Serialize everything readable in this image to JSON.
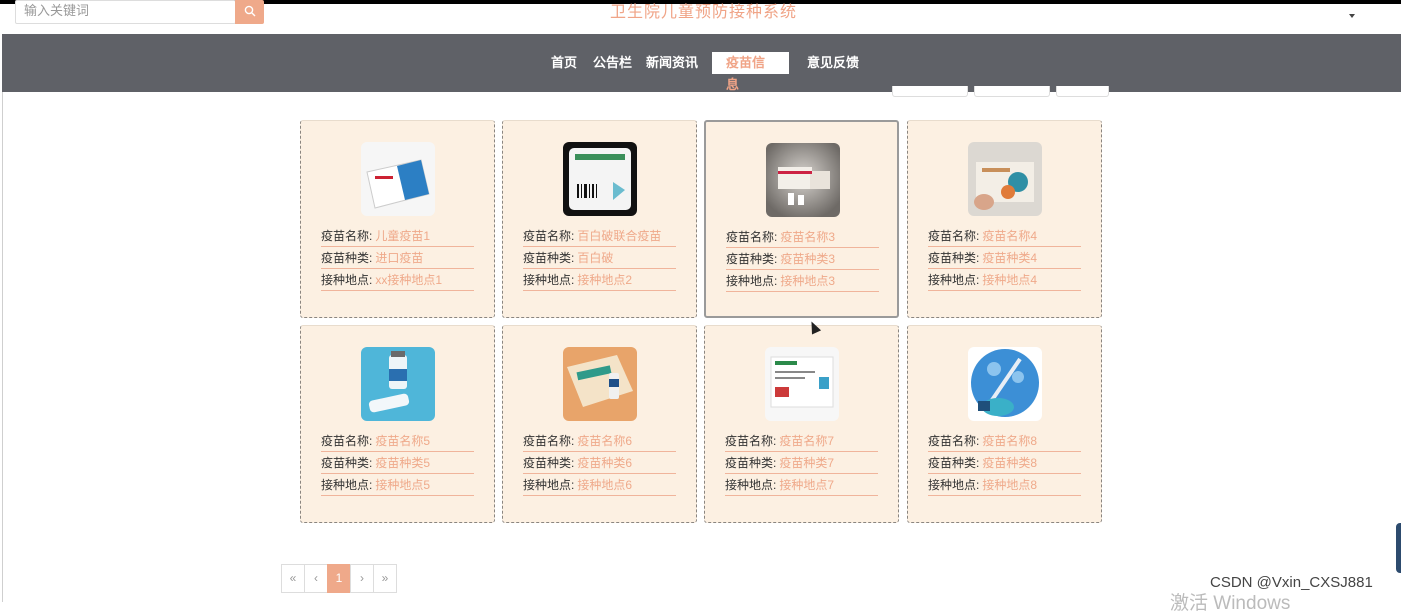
{
  "header": {
    "search_placeholder": "输入关键词",
    "search_icon": "search-icon",
    "site_title": "卫生院儿童预防接种系统"
  },
  "nav": {
    "items": [
      {
        "label": "首页"
      },
      {
        "label": "公告栏"
      },
      {
        "label": "新闻资讯"
      },
      {
        "label": "疫苗信息",
        "active": true
      },
      {
        "label": "意见反馈"
      }
    ]
  },
  "field_labels": {
    "name": "疫苗名称:",
    "type": "疫苗种类:",
    "place": "接种地点:"
  },
  "cards": [
    {
      "name": "儿童疫苗1",
      "type": "进口疫苗",
      "place": "xx接种地点1"
    },
    {
      "name": "百白破联合疫苗",
      "type": "百白破",
      "place": "接种地点2"
    },
    {
      "name": "疫苗名称3",
      "type": "疫苗种类3",
      "place": "接种地点3"
    },
    {
      "name": "疫苗名称4",
      "type": "疫苗种类4",
      "place": "接种地点4"
    },
    {
      "name": "疫苗名称5",
      "type": "疫苗种类5",
      "place": "接种地点5"
    },
    {
      "name": "疫苗名称6",
      "type": "疫苗种类6",
      "place": "接种地点6"
    },
    {
      "name": "疫苗名称7",
      "type": "疫苗种类7",
      "place": "接种地点7"
    },
    {
      "name": "疫苗名称8",
      "type": "疫苗种类8",
      "place": "接种地点8"
    }
  ],
  "pagination": {
    "first": "«",
    "prev": "‹",
    "current": "1",
    "next": "›",
    "last": "»"
  },
  "watermark": "CSDN @Vxin_CXSJ881",
  "os_overlay": "激活 Windows",
  "colors": {
    "accent": "#efa98a",
    "nav_bg": "#5f6167",
    "card_bg": "#fcf0e2"
  }
}
